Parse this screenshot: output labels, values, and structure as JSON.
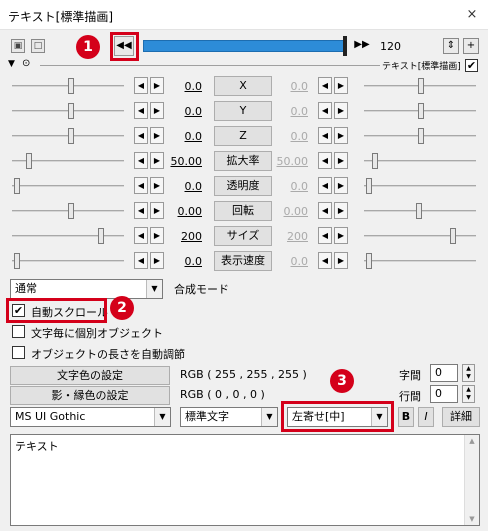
{
  "window": {
    "title": "テキスト[標準描画]",
    "close_glyph": "×"
  },
  "toolbar": {
    "icon_left": "camera-icon",
    "icon_left2": "film-icon",
    "rewind_glyph": "◀◀",
    "forward_glyph": "▶▶",
    "end_frame": "120",
    "icon_right1": "reload-icon",
    "icon_right1_glyph": "⇕",
    "icon_right2": "add-icon",
    "icon_right2_glyph": "+"
  },
  "layer": {
    "collapse_glyph": "▼",
    "mouse_glyph": "⊙",
    "label": "テキスト[標準描画]",
    "check": "✔"
  },
  "params": [
    {
      "name": "X",
      "left": "0.0",
      "right": "0.0"
    },
    {
      "name": "Y",
      "left": "0.0",
      "right": "0.0"
    },
    {
      "name": "Z",
      "left": "0.0",
      "right": "0.0"
    },
    {
      "name": "拡大率",
      "left": "50.00",
      "right": "50.00"
    },
    {
      "name": "透明度",
      "left": "0.0",
      "right": "0.0"
    },
    {
      "name": "回転",
      "left": "0.00",
      "right": "0.00"
    },
    {
      "name": "サイズ",
      "left": "200",
      "right": "200"
    },
    {
      "name": "表示速度",
      "left": "0.0",
      "right": "0.0"
    }
  ],
  "blend": {
    "value": "通常",
    "label": "合成モード"
  },
  "options": {
    "auto_scroll": "自動スクロール",
    "per_char": "文字毎に個別オブジェクト",
    "auto_length": "オブジェクトの長さを自動調節",
    "auto_scroll_checked": "✔"
  },
  "colors": {
    "text_color_btn": "文字色の設定",
    "text_color_value": "RGB ( 255 , 255 , 255 )",
    "shadow_color_btn": "影・縁色の設定",
    "shadow_color_value": "RGB ( 0 , 0 , 0 )"
  },
  "spacing": {
    "char_label": "字間",
    "char_value": "0",
    "line_label": "行間",
    "line_value": "0"
  },
  "font": {
    "family": "MS UI Gothic",
    "style": "標準文字",
    "align": "左寄せ[中]",
    "bold": "B",
    "italic": "I",
    "detail": "詳細"
  },
  "text_content": "テキスト",
  "annotations": [
    {
      "number": "1"
    },
    {
      "number": "2"
    },
    {
      "number": "3"
    }
  ],
  "accent": {
    "highlight": "#d4001a",
    "timeline": "#2d8cd8"
  }
}
